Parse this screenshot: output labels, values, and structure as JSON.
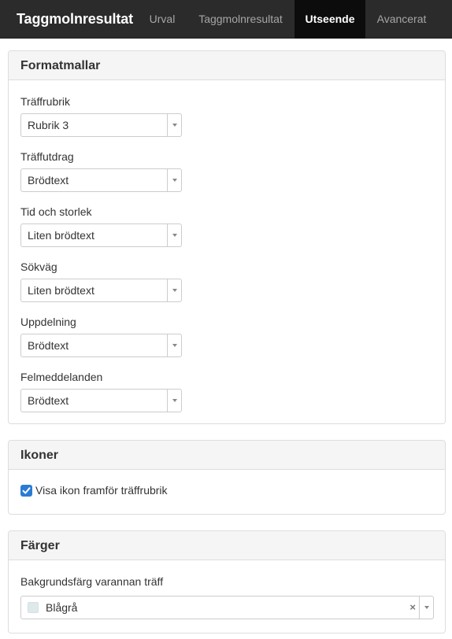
{
  "navbar": {
    "brand": "Taggmolnresultat",
    "tabs": [
      {
        "label": "Urval",
        "active": false
      },
      {
        "label": "Taggmolnresultat",
        "active": false
      },
      {
        "label": "Utseende",
        "active": true
      },
      {
        "label": "Avancerat",
        "active": false
      }
    ]
  },
  "formatmallar": {
    "title": "Formatmallar",
    "fields": [
      {
        "label": "Träffrubrik",
        "value": "Rubrik 3"
      },
      {
        "label": "Träffutdrag",
        "value": "Brödtext"
      },
      {
        "label": "Tid och storlek",
        "value": "Liten brödtext"
      },
      {
        "label": "Sökväg",
        "value": "Liten brödtext"
      },
      {
        "label": "Uppdelning",
        "value": "Brödtext"
      },
      {
        "label": "Felmeddelanden",
        "value": "Brödtext"
      }
    ]
  },
  "ikoner": {
    "title": "Ikoner",
    "checkbox_label": "Visa ikon framför träffrubrik",
    "checked": true
  },
  "farger": {
    "title": "Färger",
    "field_label": "Bakgrundsfärg varannan träff",
    "value": "Blågrå",
    "swatch_color": "#dfe9e9",
    "clear_symbol": "×"
  },
  "colors": {
    "navbar_bg": "#2b2b2b",
    "active_tab_bg": "#0c0c0c",
    "checkbox_blue": "#2b7bd4"
  }
}
